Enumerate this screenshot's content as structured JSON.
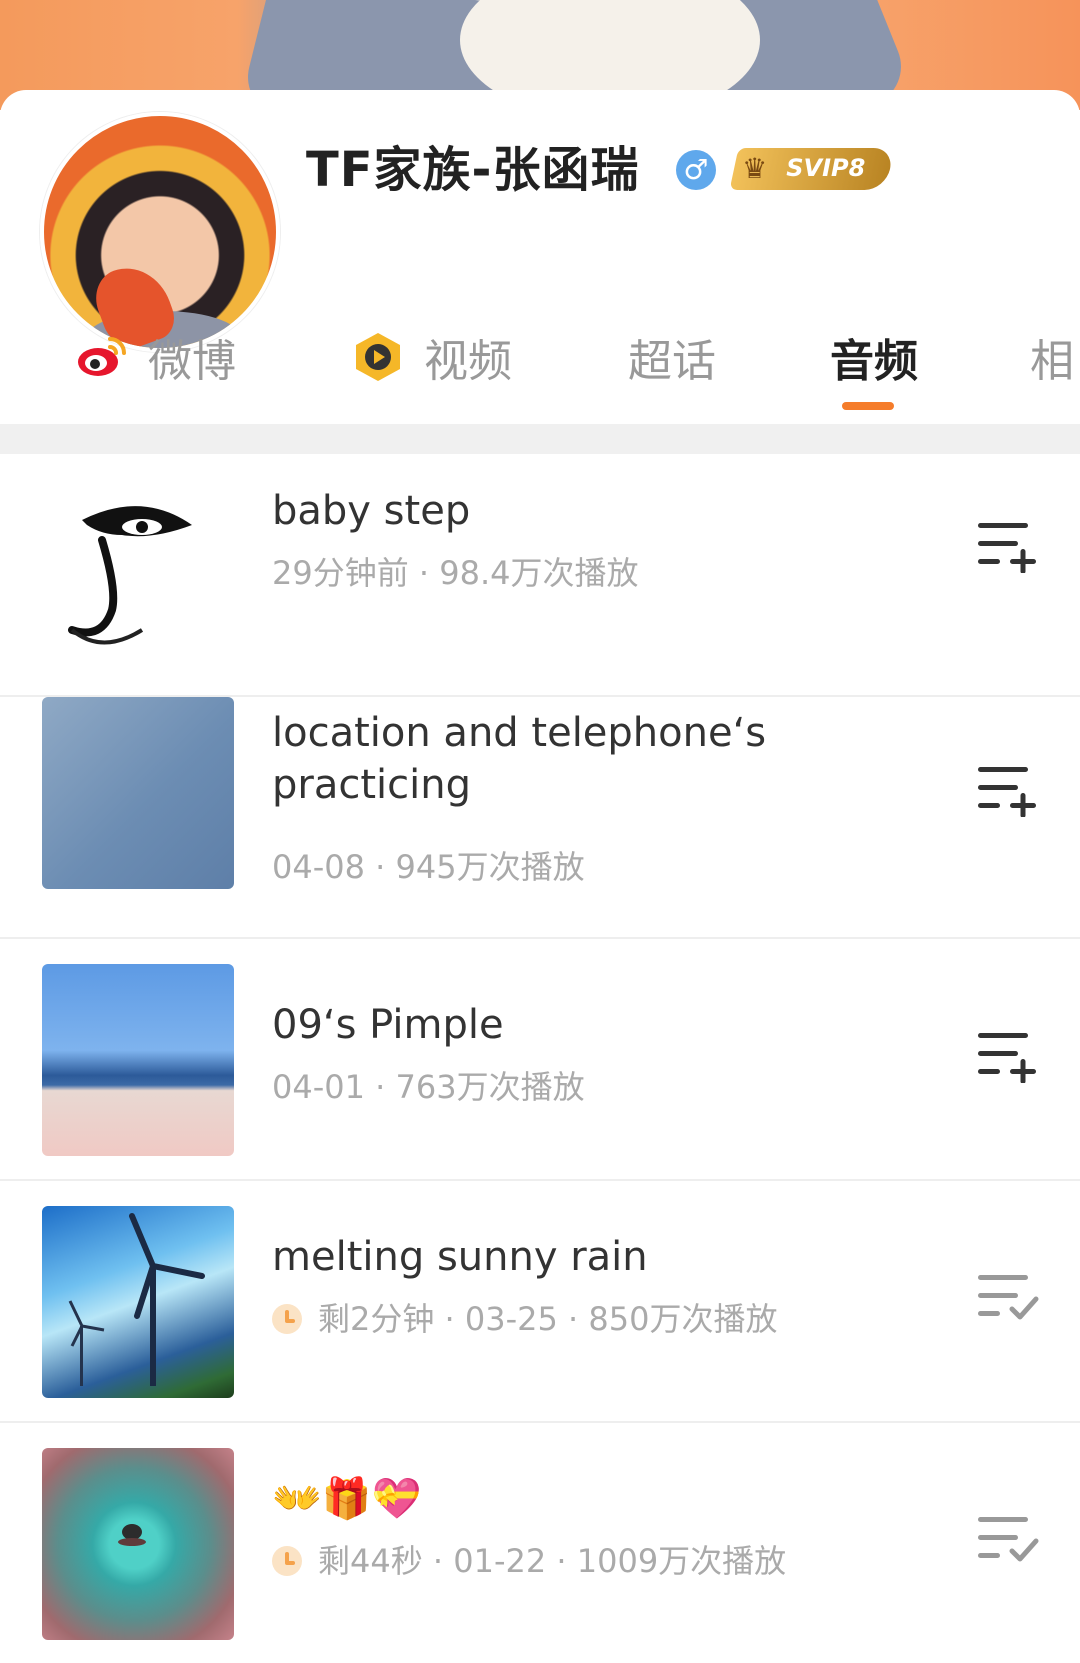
{
  "profile": {
    "username": "TF家族-张函瑞",
    "gender_symbol": "♂",
    "vip_label": "SVIP8",
    "accent_color": "#f57c2a"
  },
  "tabs": [
    {
      "label": "微博",
      "icon": "weibo-icon",
      "active": false
    },
    {
      "label": "视频",
      "icon": "video-icon",
      "active": false
    },
    {
      "label": "超话",
      "active": false
    },
    {
      "label": "音频",
      "active": true
    },
    {
      "label": "相",
      "active": false
    }
  ],
  "audio_list": [
    {
      "title": "baby step",
      "meta": "29分钟前 · 98.4万次播放",
      "action_icon": "add-to-playlist-icon"
    },
    {
      "title": "location and telephone‘s practicing",
      "meta": "04-08 · 945万次播放",
      "action_icon": "add-to-playlist-icon"
    },
    {
      "title": "09‘s Pimple",
      "meta": "04-01 · 763万次播放",
      "action_icon": "add-to-playlist-icon"
    },
    {
      "title": "melting sunny rain",
      "meta": "剩2分钟 · 03-25 · 850万次播放",
      "remaining_icon": "clock-icon",
      "action_icon": "added-to-playlist-icon"
    },
    {
      "title": "👐🎁💝",
      "meta": "剩44秒 · 01-22 · 1009万次播放",
      "remaining_icon": "clock-icon",
      "action_icon": "added-to-playlist-icon"
    }
  ]
}
